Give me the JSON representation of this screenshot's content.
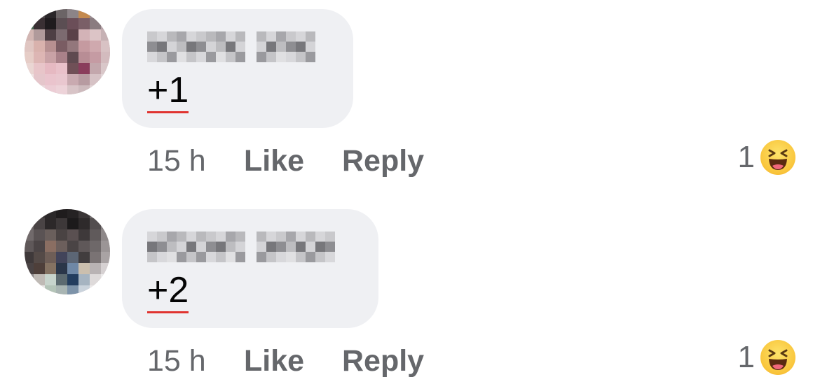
{
  "comments": [
    {
      "text": "+1",
      "time": "15 h",
      "like_label": "Like",
      "reply_label": "Reply",
      "reaction_count": "1",
      "reaction_icon": "haha-emoji-icon",
      "avatar_colors": [
        [
          "#7e8f7a",
          "#4b4548",
          "#2a2629",
          "#6b6466",
          "#8c8488",
          "#c48a4f",
          "#9b8e92",
          "#a79b9e"
        ],
        [
          "#4e6c57",
          "#3a3034",
          "#1f1b1e",
          "#5b4e53",
          "#6b4e58",
          "#7a5f67",
          "#8a7c80",
          "#b5a3a7"
        ],
        [
          "#d2b6b3",
          "#b09a9b",
          "#4e3f44",
          "#7c6b70",
          "#5a4148",
          "#d3b3b7",
          "#dcc4c6",
          "#c6b1b4"
        ],
        [
          "#e0c6c2",
          "#d9b2ad",
          "#b79091",
          "#7a5c63",
          "#93777c",
          "#c59aa0",
          "#cfa9ae",
          "#d8c2c4"
        ],
        [
          "#e6cdc7",
          "#ddb6b4",
          "#c9a2a6",
          "#a98189",
          "#5f4a50",
          "#b88d95",
          "#c59ba3",
          "#d3bbbe"
        ],
        [
          "#ead6d3",
          "#e8c5c9",
          "#e6b9c2",
          "#e9c1ca",
          "#705057",
          "#8a3d5c",
          "#c3a7ac",
          "#d9c7c9"
        ],
        [
          "#f0e4e3",
          "#e5c6cb",
          "#eac4cd",
          "#e9c7cf",
          "#c9aab0",
          "#b79ba1",
          "#d6c2c5",
          "#e1d4d6"
        ],
        [
          "#f3ecec",
          "#ead8db",
          "#eccdd5",
          "#edd3d9",
          "#d8c4c7",
          "#cdbabd",
          "#e1d3d5",
          "#ebe2e3"
        ]
      ]
    },
    {
      "text": "+2",
      "time": "15 h",
      "like_label": "Like",
      "reply_label": "Reply",
      "reaction_count": "1",
      "reaction_icon": "haha-emoji-icon",
      "avatar_colors": [
        [
          "#8b8587",
          "#3b3738",
          "#2b2829",
          "#1f1c1d",
          "#252223",
          "#3a3637",
          "#6e6a6b",
          "#a29e9f"
        ],
        [
          "#6a6465",
          "#4a4445",
          "#2c2829",
          "#3d3839",
          "#1c1a1b",
          "#2e2a2b",
          "#534e4f",
          "#837e7f"
        ],
        [
          "#716a6b",
          "#5a5354",
          "#6a5f5c",
          "#4a4343",
          "#5a5051",
          "#3e393a",
          "#605a5b",
          "#8e8889"
        ],
        [
          "#5f5859",
          "#4c4546",
          "#8a6e62",
          "#6c5f5c",
          "#4a4445",
          "#5f5859",
          "#6e6869",
          "#9b9596"
        ],
        [
          "#3f393a",
          "#544a47",
          "#6e5e57",
          "#42445a",
          "#5c6675",
          "#413d3e",
          "#7a7374",
          "#a9a3a4"
        ],
        [
          "#4a4344",
          "#4e3f3a",
          "#847262",
          "#2a3649",
          "#6f88a6",
          "#cbbfae",
          "#b9b3b4",
          "#d6d1d2"
        ],
        [
          "#8f8a8b",
          "#bfbab5",
          "#c7d4cc",
          "#5c6a70",
          "#233d5e",
          "#a6b4c1",
          "#dedada",
          "#ecebeb"
        ],
        [
          "#d8d5d6",
          "#e9e6e6",
          "#b4c4b8",
          "#a9b5b3",
          "#7d93a9",
          "#cad3dc",
          "#ebe9e9",
          "#f4f3f3"
        ]
      ]
    }
  ]
}
